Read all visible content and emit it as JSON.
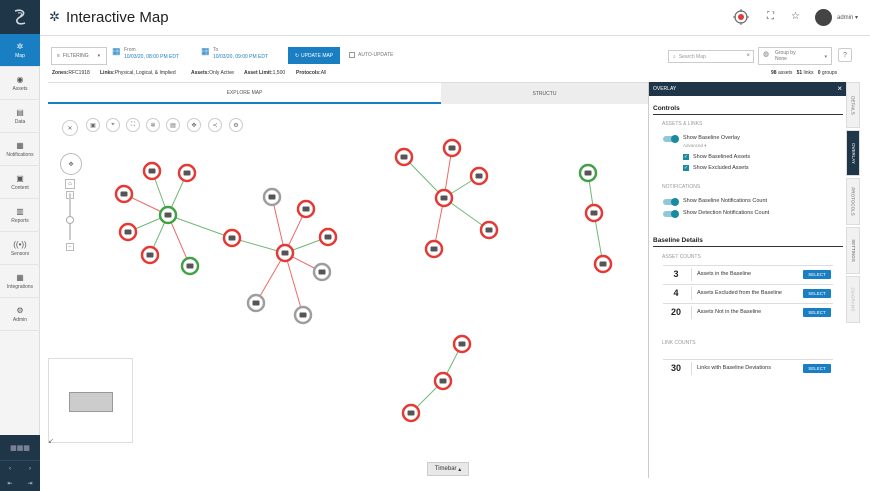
{
  "app": {
    "title": "Interactive Map",
    "user": "admin"
  },
  "nav": {
    "items": [
      {
        "label": "Map",
        "icon": "✲"
      },
      {
        "label": "Assets",
        "icon": "◉"
      },
      {
        "label": "Data",
        "icon": "▤"
      },
      {
        "label": "Notifications",
        "icon": "▦"
      },
      {
        "label": "Content",
        "icon": "▣"
      },
      {
        "label": "Reports",
        "icon": "▥"
      },
      {
        "label": "Sensors",
        "icon": "((•))"
      },
      {
        "label": "Integrations",
        "icon": "▦"
      },
      {
        "label": "Admin",
        "icon": "⚙"
      }
    ]
  },
  "toolbar": {
    "filter_label": "FILTERING",
    "from_label": "From",
    "from_value": "10/03/20, 08:00 PM EDT",
    "to_label": "To",
    "to_value": "10/03/20, 09:00 PM EDT",
    "update_label": "UPDATE MAP",
    "auto_update_label": "AUTO-UPDATE",
    "search_placeholder": "Search Map",
    "groupby_label": "Group by",
    "groupby_value": "None"
  },
  "infobar": {
    "zones_label": "Zones:",
    "zones_value": "RFC1918",
    "links_label": "Links:",
    "links_value": "Physical, Logical, & Implied",
    "assets_label": "Assets:",
    "assets_value": "Only Active",
    "limit_label": "Asset Limit:",
    "limit_value": "1,500",
    "protocols_label": "Protocols:",
    "protocols_value": "All",
    "assets_count": "98",
    "assets_word": "assets",
    "links_count": "51",
    "links_word": "links",
    "groups_count": "0",
    "groups_word": "groups"
  },
  "tabs": {
    "explore": "EXPLORE MAP",
    "structure": "STRUCTU"
  },
  "timebar": "Timebar",
  "panel": {
    "header": "OVERLAY",
    "controls_title": "Controls",
    "assets_links_label": "ASSETS & LINKS",
    "show_baseline_overlay": "Show Baseline Overlay",
    "advanced": "Advanced",
    "show_baselined_assets": "Show Baselined Assets",
    "show_excluded_assets": "Show Excluded Assets",
    "notifications_label": "NOTIFICATIONS",
    "show_baseline_notif": "Show Baseline Notifications Count",
    "show_detection_notif": "Show Detection Notifications Count",
    "baseline_details_title": "Baseline Details",
    "asset_counts_label": "ASSET COUNTS",
    "asset_counts": [
      {
        "num": "3",
        "label": "Assets in the Baseline"
      },
      {
        "num": "4",
        "label": "Assets Excluded from the Baseline"
      },
      {
        "num": "20",
        "label": "Assets Not in the Baseline"
      }
    ],
    "link_counts_label": "LINK COUNTS",
    "link_counts": [
      {
        "num": "30",
        "label": "Links with Baseline Deviations"
      }
    ],
    "select_label": "SELECT"
  },
  "vtabs": [
    "DETAILS",
    "OVERLAY",
    "PROTOCOLS",
    "SETTINGS",
    "DIAGRAMS"
  ],
  "colors": {
    "accent": "#1a7ec2",
    "navy": "#1f3548",
    "red": "#e53935",
    "green": "#43a047",
    "gray": "#9e9e9e"
  }
}
